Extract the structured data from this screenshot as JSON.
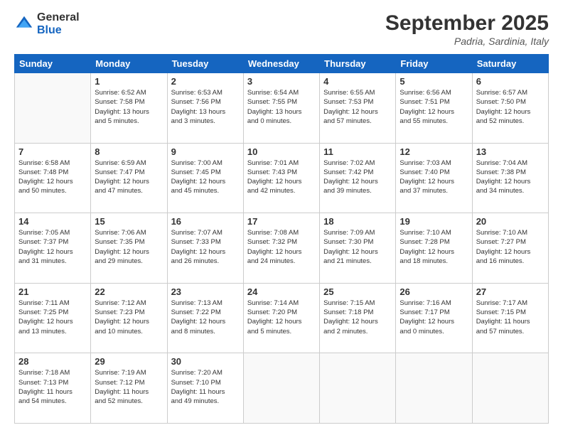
{
  "header": {
    "logo_line1": "General",
    "logo_line2": "Blue",
    "month_title": "September 2025",
    "location": "Padria, Sardinia, Italy"
  },
  "days_of_week": [
    "Sunday",
    "Monday",
    "Tuesday",
    "Wednesday",
    "Thursday",
    "Friday",
    "Saturday"
  ],
  "weeks": [
    [
      {
        "day": "",
        "info": ""
      },
      {
        "day": "1",
        "info": "Sunrise: 6:52 AM\nSunset: 7:58 PM\nDaylight: 13 hours\nand 5 minutes."
      },
      {
        "day": "2",
        "info": "Sunrise: 6:53 AM\nSunset: 7:56 PM\nDaylight: 13 hours\nand 3 minutes."
      },
      {
        "day": "3",
        "info": "Sunrise: 6:54 AM\nSunset: 7:55 PM\nDaylight: 13 hours\nand 0 minutes."
      },
      {
        "day": "4",
        "info": "Sunrise: 6:55 AM\nSunset: 7:53 PM\nDaylight: 12 hours\nand 57 minutes."
      },
      {
        "day": "5",
        "info": "Sunrise: 6:56 AM\nSunset: 7:51 PM\nDaylight: 12 hours\nand 55 minutes."
      },
      {
        "day": "6",
        "info": "Sunrise: 6:57 AM\nSunset: 7:50 PM\nDaylight: 12 hours\nand 52 minutes."
      }
    ],
    [
      {
        "day": "7",
        "info": "Sunrise: 6:58 AM\nSunset: 7:48 PM\nDaylight: 12 hours\nand 50 minutes."
      },
      {
        "day": "8",
        "info": "Sunrise: 6:59 AM\nSunset: 7:47 PM\nDaylight: 12 hours\nand 47 minutes."
      },
      {
        "day": "9",
        "info": "Sunrise: 7:00 AM\nSunset: 7:45 PM\nDaylight: 12 hours\nand 45 minutes."
      },
      {
        "day": "10",
        "info": "Sunrise: 7:01 AM\nSunset: 7:43 PM\nDaylight: 12 hours\nand 42 minutes."
      },
      {
        "day": "11",
        "info": "Sunrise: 7:02 AM\nSunset: 7:42 PM\nDaylight: 12 hours\nand 39 minutes."
      },
      {
        "day": "12",
        "info": "Sunrise: 7:03 AM\nSunset: 7:40 PM\nDaylight: 12 hours\nand 37 minutes."
      },
      {
        "day": "13",
        "info": "Sunrise: 7:04 AM\nSunset: 7:38 PM\nDaylight: 12 hours\nand 34 minutes."
      }
    ],
    [
      {
        "day": "14",
        "info": "Sunrise: 7:05 AM\nSunset: 7:37 PM\nDaylight: 12 hours\nand 31 minutes."
      },
      {
        "day": "15",
        "info": "Sunrise: 7:06 AM\nSunset: 7:35 PM\nDaylight: 12 hours\nand 29 minutes."
      },
      {
        "day": "16",
        "info": "Sunrise: 7:07 AM\nSunset: 7:33 PM\nDaylight: 12 hours\nand 26 minutes."
      },
      {
        "day": "17",
        "info": "Sunrise: 7:08 AM\nSunset: 7:32 PM\nDaylight: 12 hours\nand 24 minutes."
      },
      {
        "day": "18",
        "info": "Sunrise: 7:09 AM\nSunset: 7:30 PM\nDaylight: 12 hours\nand 21 minutes."
      },
      {
        "day": "19",
        "info": "Sunrise: 7:10 AM\nSunset: 7:28 PM\nDaylight: 12 hours\nand 18 minutes."
      },
      {
        "day": "20",
        "info": "Sunrise: 7:10 AM\nSunset: 7:27 PM\nDaylight: 12 hours\nand 16 minutes."
      }
    ],
    [
      {
        "day": "21",
        "info": "Sunrise: 7:11 AM\nSunset: 7:25 PM\nDaylight: 12 hours\nand 13 minutes."
      },
      {
        "day": "22",
        "info": "Sunrise: 7:12 AM\nSunset: 7:23 PM\nDaylight: 12 hours\nand 10 minutes."
      },
      {
        "day": "23",
        "info": "Sunrise: 7:13 AM\nSunset: 7:22 PM\nDaylight: 12 hours\nand 8 minutes."
      },
      {
        "day": "24",
        "info": "Sunrise: 7:14 AM\nSunset: 7:20 PM\nDaylight: 12 hours\nand 5 minutes."
      },
      {
        "day": "25",
        "info": "Sunrise: 7:15 AM\nSunset: 7:18 PM\nDaylight: 12 hours\nand 2 minutes."
      },
      {
        "day": "26",
        "info": "Sunrise: 7:16 AM\nSunset: 7:17 PM\nDaylight: 12 hours\nand 0 minutes."
      },
      {
        "day": "27",
        "info": "Sunrise: 7:17 AM\nSunset: 7:15 PM\nDaylight: 11 hours\nand 57 minutes."
      }
    ],
    [
      {
        "day": "28",
        "info": "Sunrise: 7:18 AM\nSunset: 7:13 PM\nDaylight: 11 hours\nand 54 minutes."
      },
      {
        "day": "29",
        "info": "Sunrise: 7:19 AM\nSunset: 7:12 PM\nDaylight: 11 hours\nand 52 minutes."
      },
      {
        "day": "30",
        "info": "Sunrise: 7:20 AM\nSunset: 7:10 PM\nDaylight: 11 hours\nand 49 minutes."
      },
      {
        "day": "",
        "info": ""
      },
      {
        "day": "",
        "info": ""
      },
      {
        "day": "",
        "info": ""
      },
      {
        "day": "",
        "info": ""
      }
    ]
  ]
}
